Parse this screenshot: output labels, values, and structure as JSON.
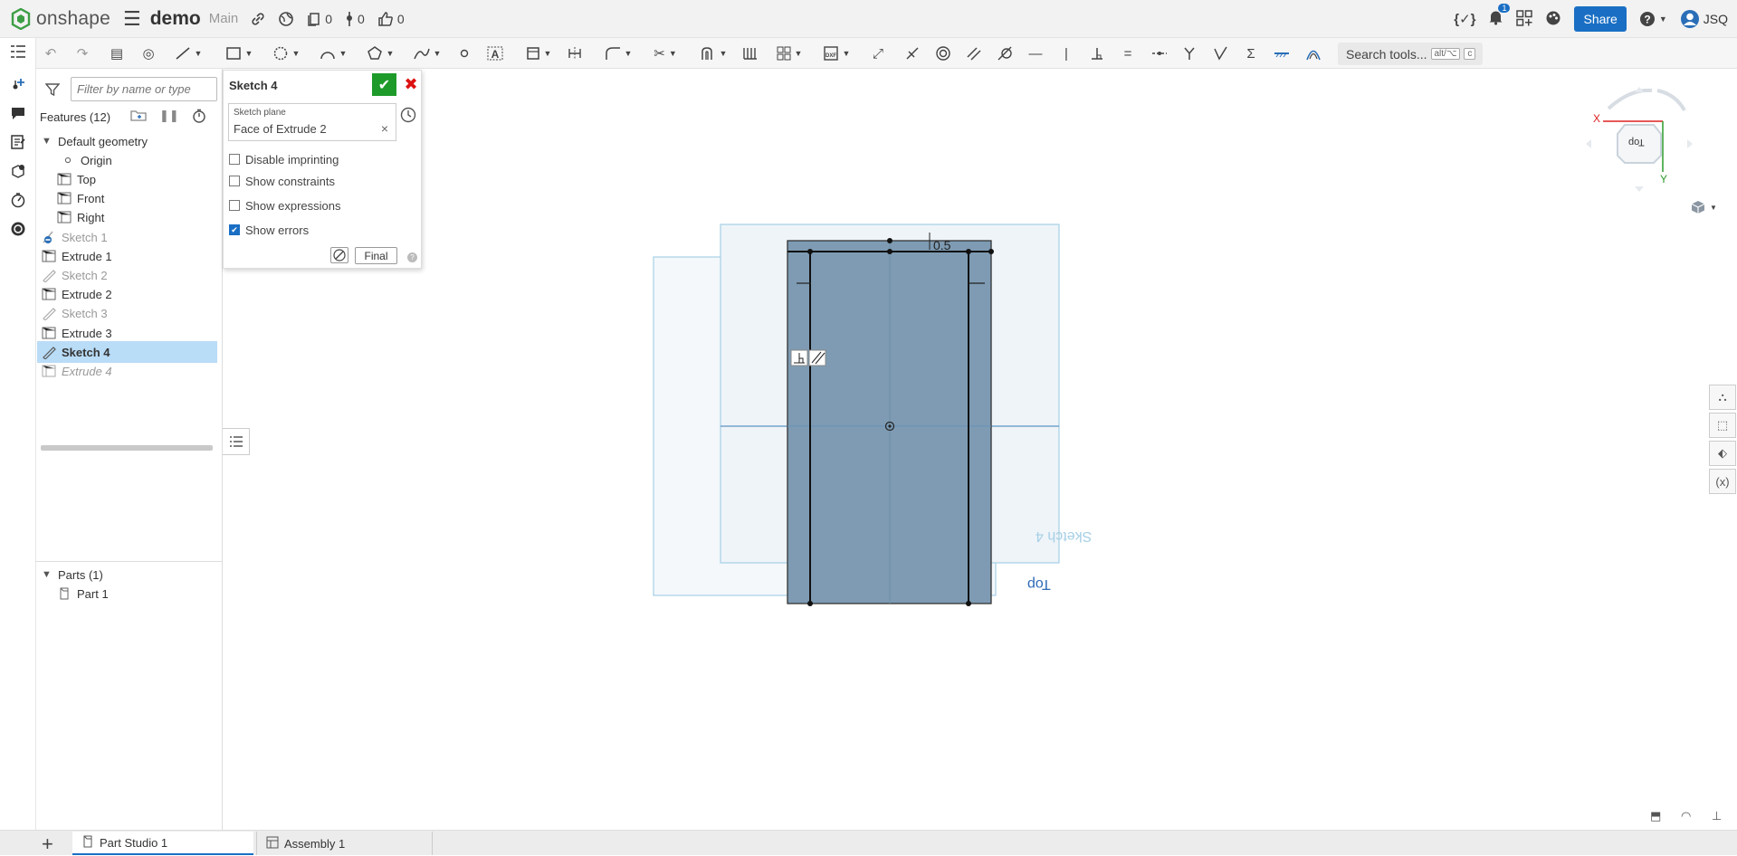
{
  "topbar": {
    "logo_text": "onshape",
    "doc_name": "demo",
    "branch": "Main",
    "versions_count": "0",
    "history_count": "0",
    "likes_count": "0",
    "notifications_count": "1",
    "share_label": "Share",
    "user_initials": "JSQ"
  },
  "toolbar": {
    "search_label": "Search tools...",
    "search_shortcut_1": "alt/⌥",
    "search_shortcut_2": "c"
  },
  "feature_panel": {
    "filter_placeholder": "Filter by name or type",
    "features_header": "Features (12)",
    "default_geometry": "Default geometry",
    "items": [
      {
        "label": "Origin"
      },
      {
        "label": "Top"
      },
      {
        "label": "Front"
      },
      {
        "label": "Right"
      },
      {
        "label": "Sketch 1"
      },
      {
        "label": "Extrude 1"
      },
      {
        "label": "Sketch 2"
      },
      {
        "label": "Extrude 2"
      },
      {
        "label": "Sketch 3"
      },
      {
        "label": "Extrude 3"
      },
      {
        "label": "Sketch 4"
      },
      {
        "label": "Extrude 4"
      }
    ],
    "parts_header": "Parts (1)",
    "parts": [
      {
        "label": "Part 1"
      }
    ]
  },
  "sketch_dialog": {
    "title": "Sketch 4",
    "plane_label": "Sketch plane",
    "plane_value": "Face of Extrude 2",
    "options": [
      {
        "label": "Disable imprinting",
        "checked": false
      },
      {
        "label": "Show constraints",
        "checked": false
      },
      {
        "label": "Show expressions",
        "checked": false
      },
      {
        "label": "Show errors",
        "checked": true
      }
    ],
    "final_label": "Final"
  },
  "viewport": {
    "dimension_label": "0.5",
    "sketch_label": "Sketch 4",
    "plane_label": "Top",
    "view_cube_label": "Top",
    "axis_x": "X",
    "axis_y": "Y"
  },
  "bottom_tabs": [
    {
      "label": "Part Studio 1",
      "active": true
    },
    {
      "label": "Assembly 1",
      "active": false
    }
  ],
  "colors": {
    "accent": "#1a6fc4",
    "confirm_green": "#1e9a2a",
    "cancel_red": "#dd1111",
    "selection": "#b9dcf7",
    "part_face": "#7e9bb3"
  }
}
